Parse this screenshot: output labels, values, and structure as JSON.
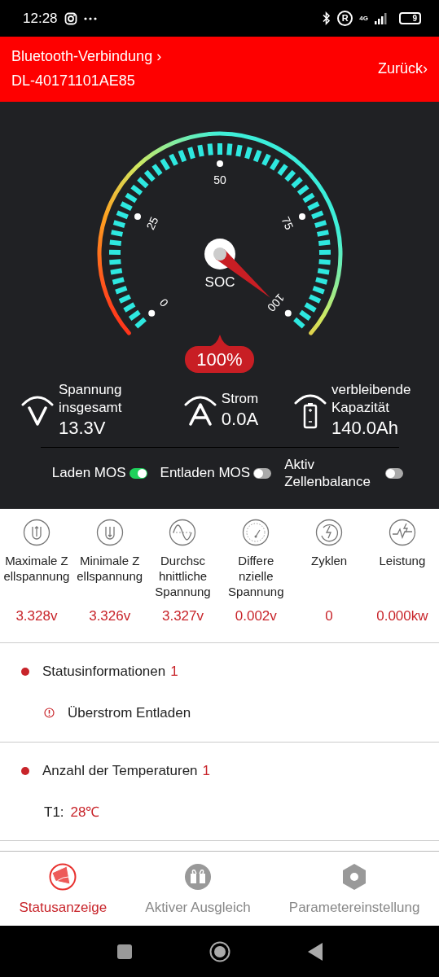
{
  "status_bar": {
    "time": "12:28",
    "roaming": "R",
    "network": "4G",
    "battery": "9"
  },
  "header": {
    "connection": "Bluetooth-Verbindung",
    "connection_arrow": "›",
    "device": "DL-40171101AE85",
    "back": "Zurück",
    "back_arrow": "›"
  },
  "gauge": {
    "label": "SOC",
    "reading": "100%",
    "ticks": [
      "0",
      "25",
      "50",
      "75",
      "100"
    ]
  },
  "readings": [
    {
      "kind": "voltage",
      "label": "Spannung insgesamt",
      "value": "13.3V"
    },
    {
      "kind": "current",
      "label": "Strom",
      "value": "0.0A"
    },
    {
      "kind": "capacity",
      "label": "verbleibende Kapazität",
      "value": "140.0Ah"
    }
  ],
  "switches": [
    {
      "label": "Laden MOS",
      "on": true
    },
    {
      "label": "Entladen MOS",
      "on": false
    },
    {
      "label": "Aktiv Zellenbalance",
      "on": false
    }
  ],
  "metrics": [
    {
      "kind": "max",
      "label": "Maximale Z ellspannung",
      "value": "3.328v"
    },
    {
      "kind": "min",
      "label": "Minimale Z ellspannung",
      "value": "3.326v"
    },
    {
      "kind": "avg",
      "label": "Durchsc hnittliche Spannung",
      "value": "3.327v"
    },
    {
      "kind": "diff",
      "label": "Differe nzielle Spannung",
      "value": "0.002v"
    },
    {
      "kind": "cycles",
      "label": "Zyklen",
      "value": "0"
    },
    {
      "kind": "power",
      "label": "Leistung",
      "value": "0.000kw"
    }
  ],
  "status_info": {
    "title": "Statusinformationen",
    "count": "1",
    "items": [
      "Überstrom Entladen"
    ]
  },
  "temperatures": {
    "title": "Anzahl der Temperaturen",
    "count": "1",
    "items": [
      {
        "name": "T1:",
        "value": "28℃"
      }
    ]
  },
  "tabs": [
    {
      "kind": "status",
      "label": "Statusanzeige",
      "selected": true
    },
    {
      "kind": "balance",
      "label": "Aktiver Ausgleich",
      "selected": false
    },
    {
      "kind": "settings",
      "label": "Parametereinstellung",
      "selected": false
    }
  ]
}
